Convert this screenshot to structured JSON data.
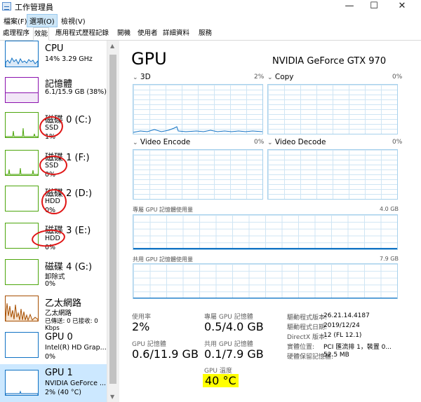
{
  "window": {
    "title": "工作管理員",
    "minimize": "—",
    "maximize": "☐",
    "close": "✕"
  },
  "menu": [
    "檔案(F)",
    "選項(O)",
    "檢視(V)"
  ],
  "tabs": [
    "處理程序",
    "效能",
    "應用程式歷程記錄",
    "開機",
    "使用者",
    "詳細資料",
    "服務"
  ],
  "sidebar": [
    {
      "name": "CPU",
      "d1": "14%  3.29 GHz",
      "d2": ""
    },
    {
      "name": "記憶體",
      "d1": "6.1/15.9 GB (38%)",
      "d2": ""
    },
    {
      "name": "磁碟 0 (C:)",
      "d1": "SSD",
      "d2": "1%"
    },
    {
      "name": "磁碟 1 (F:)",
      "d1": "SSD",
      "d2": "0%"
    },
    {
      "name": "磁碟 2 (D:)",
      "d1": "HDD",
      "d2": "0%"
    },
    {
      "name": "磁碟 3 (E:)",
      "d1": "HDD",
      "d2": "0%"
    },
    {
      "name": "磁碟 4 (G:)",
      "d1": "卸除式",
      "d2": "0%"
    },
    {
      "name": "乙太網路",
      "d1": "乙太網路",
      "d2": "已傳送: 0  已接收: 0 Kbps"
    },
    {
      "name": "GPU 0",
      "d1": "Intel(R) HD Grap...",
      "d2": "0%"
    },
    {
      "name": "GPU 1",
      "d1": "NVIDIA GeForce ...",
      "d2": "2% (40 °C)"
    }
  ],
  "main": {
    "title": "GPU",
    "model": "NVIDIA GeForce GTX 970",
    "engines": [
      {
        "name": "3D",
        "value": "2%"
      },
      {
        "name": "Copy",
        "value": "0%"
      },
      {
        "name": "Video Encode",
        "value": "0%"
      },
      {
        "name": "Video Decode",
        "value": "0%"
      }
    ],
    "dedicated_label": "專屬 GPU 記憶體使用量",
    "dedicated_max": "4.0 GB",
    "shared_label": "共用 GPU 記憶體使用量",
    "shared_max": "7.9 GB",
    "stats": {
      "utilization_label": "使用率",
      "utilization": "2%",
      "dedicated_mem_label": "專屬 GPU 記憶體",
      "dedicated_mem": "0.5/4.0 GB",
      "gpu_mem_label": "GPU 記憶體",
      "gpu_mem": "0.6/11.9 GB",
      "shared_mem_label": "共用 GPU 記憶體",
      "shared_mem": "0.1/7.9 GB",
      "temp_label": "GPU 溫度",
      "temp": "40 °C"
    },
    "info": [
      {
        "k": "驅動程式版本:",
        "v": "26.21.14.4187"
      },
      {
        "k": "驅動程式日期:",
        "v": "2019/12/24"
      },
      {
        "k": "DirectX 版本:",
        "v": "12 (FL 12.1)"
      },
      {
        "k": "實體位置:",
        "v": "PCI 匯流排 1，裝置 0..."
      },
      {
        "k": "硬體保留記憶體:",
        "v": "52.5 MB"
      }
    ]
  },
  "colors": {
    "cpu": "#1172c4",
    "memory": "#8b12ae",
    "disk": "#4da60c",
    "ethernet": "#a74f01",
    "gpu": "#1172c4",
    "highlight": "#ffff00",
    "annotation": "#e01515",
    "selection": "#cce8ff"
  }
}
